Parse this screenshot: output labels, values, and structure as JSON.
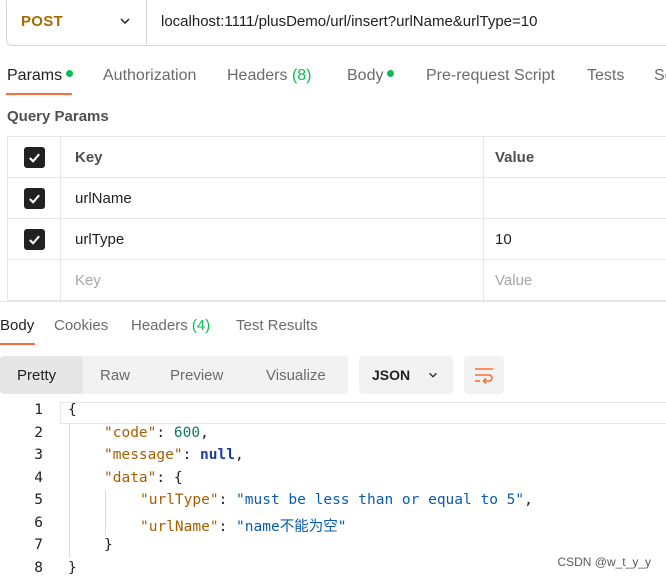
{
  "request": {
    "method": "POST",
    "url": "localhost:1111/plusDemo/url/insert?urlName&urlType=10"
  },
  "request_tabs": {
    "params": "Params",
    "authorization": "Authorization",
    "headers": "Headers",
    "headers_count": "(8)",
    "body": "Body",
    "prerequest": "Pre-request Script",
    "tests": "Tests",
    "settings_partial": "Se"
  },
  "query_params": {
    "title": "Query Params",
    "col_key": "Key",
    "col_value": "Value",
    "rows": [
      {
        "key": "urlName",
        "value": "",
        "checked": true
      },
      {
        "key": "urlType",
        "value": "10",
        "checked": true
      }
    ],
    "key_placeholder": "Key",
    "value_placeholder": "Value"
  },
  "response_tabs": {
    "body": "Body",
    "cookies": "Cookies",
    "headers": "Headers",
    "headers_count": "(4)",
    "test_results": "Test Results"
  },
  "view": {
    "pretty": "Pretty",
    "raw": "Raw",
    "preview": "Preview",
    "visualize": "Visualize",
    "format": "JSON"
  },
  "code": {
    "line_numbers": [
      "1",
      "2",
      "3",
      "4",
      "5",
      "6",
      "7",
      "8"
    ],
    "open_brace": "{",
    "code_key": "\"code\"",
    "code_value": "600",
    "message_key": "\"message\"",
    "message_value": "null",
    "data_key": "\"data\"",
    "urlType_key": "\"urlType\"",
    "urlType_value": "\"must be less than or equal to 5\"",
    "urlName_key": "\"urlName\"",
    "urlName_value": "\"name不能为空\"",
    "close_inner": "}",
    "close_outer": "}"
  },
  "watermark": "CSDN @w_t_y_y",
  "colors": {
    "accent": "#ff6c37",
    "method": "#a86a00",
    "dot": "#0cbb52"
  }
}
